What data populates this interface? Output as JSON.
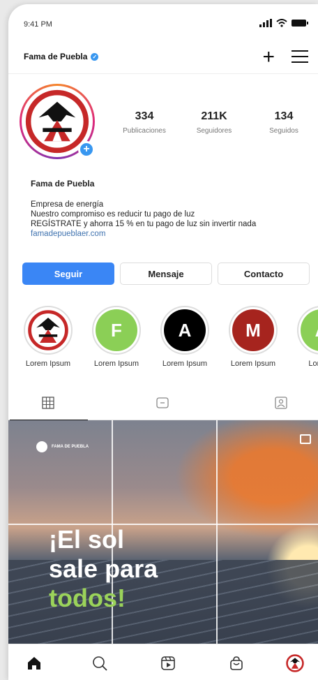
{
  "status_bar": {
    "time": "9:41 PM"
  },
  "header": {
    "username": "Fama de Puebla",
    "add_label": "+"
  },
  "profile": {
    "stats": [
      {
        "value": "334",
        "label": "Publicaciones"
      },
      {
        "value": "211K",
        "label": "Seguidores"
      },
      {
        "value": "134",
        "label": "Seguidos"
      }
    ],
    "name": "Fama de Puebla",
    "bio": [
      "Empresa de energía",
      "Nuestro compromiso es reducir tu pago de luz",
      "REGÍSTRATE y ahorra 15 % en tu pago de luz sin invertir nada"
    ],
    "link": "famadepueblaer.com"
  },
  "actions": {
    "follow": "Seguir",
    "message": "Mensaje",
    "contact": "Contacto"
  },
  "highlights": [
    {
      "letter": "",
      "label": "Lorem Ipsum",
      "color": "#ffffff"
    },
    {
      "letter": "F",
      "label": "Lorem Ipsum",
      "color": "#8bcf56"
    },
    {
      "letter": "A",
      "label": "Lorem Ipsum",
      "color": "#000000"
    },
    {
      "letter": "M",
      "label": "Lorem Ipsum",
      "color": "#a6241e"
    },
    {
      "letter": "A",
      "label": "Lorem I",
      "color": "#8bcf56"
    }
  ],
  "post": {
    "brand": "FAMA DE PUEBLA",
    "headline_1": "¡El sol",
    "headline_2": "sale para",
    "headline_3": "todos!"
  },
  "colors": {
    "accent": "#3a86f5",
    "brand_red": "#c62828"
  }
}
